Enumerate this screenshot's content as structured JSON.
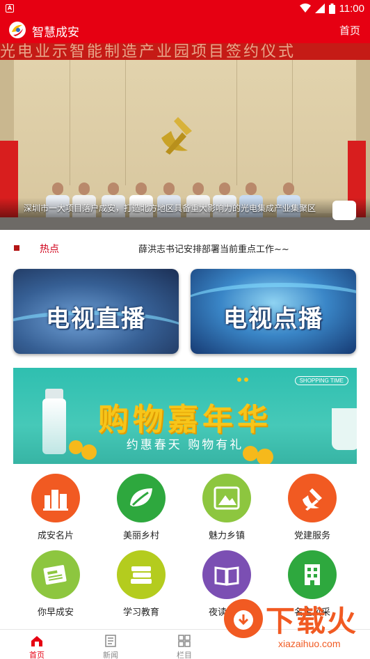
{
  "status_bar": {
    "time": "11:00",
    "notification_letter": "A"
  },
  "app_bar": {
    "title": "智慧成安",
    "home_link": "首页"
  },
  "banner": {
    "backdrop_text": "光电业示智能制造产业园项目签约仪式",
    "caption": "深圳市一大项目落户成安，打造北方地区具备重大影响力的光电集成产业集聚区"
  },
  "hot": {
    "label": "热点",
    "headline": "薛洪志书记安排部署当前重点工作~~"
  },
  "tv_cards": [
    {
      "label": "电视直播"
    },
    {
      "label": "电视点播"
    }
  ],
  "shop_banner": {
    "title": "购物嘉年华",
    "subtitle": "约惠春天 购物有礼",
    "tag": "SHOPPING TIME"
  },
  "grid": [
    {
      "label": "成安名片",
      "icon": "buildings-icon",
      "color": "#f15a22"
    },
    {
      "label": "美丽乡村",
      "icon": "leaf-icon",
      "color": "#2ea83e"
    },
    {
      "label": "魅力乡镇",
      "icon": "landscape-icon",
      "color": "#8dc63f"
    },
    {
      "label": "党建服务",
      "icon": "party-emblem-icon",
      "color": "#f15a22"
    },
    {
      "label": "你早成安",
      "icon": "newspaper-icon",
      "color": "#8dc63f"
    },
    {
      "label": "学习教育",
      "icon": "books-icon",
      "color": "#b4cc1e"
    },
    {
      "label": "夜读时空",
      "icon": "open-book-icon",
      "color": "#7b4fb3"
    },
    {
      "label": "名企风采",
      "icon": "office-building-icon",
      "color": "#2ea83e"
    }
  ],
  "bottom_nav": [
    {
      "label": "首页",
      "icon": "home-icon",
      "active": true
    },
    {
      "label": "新闻",
      "icon": "news-icon",
      "active": false
    },
    {
      "label": "栏目",
      "icon": "grid-icon",
      "active": false
    }
  ],
  "watermark": {
    "text": "下载火",
    "url": "xiazaihuo.com"
  },
  "colors": {
    "primary": "#e60012",
    "hot": "#d0021b"
  }
}
